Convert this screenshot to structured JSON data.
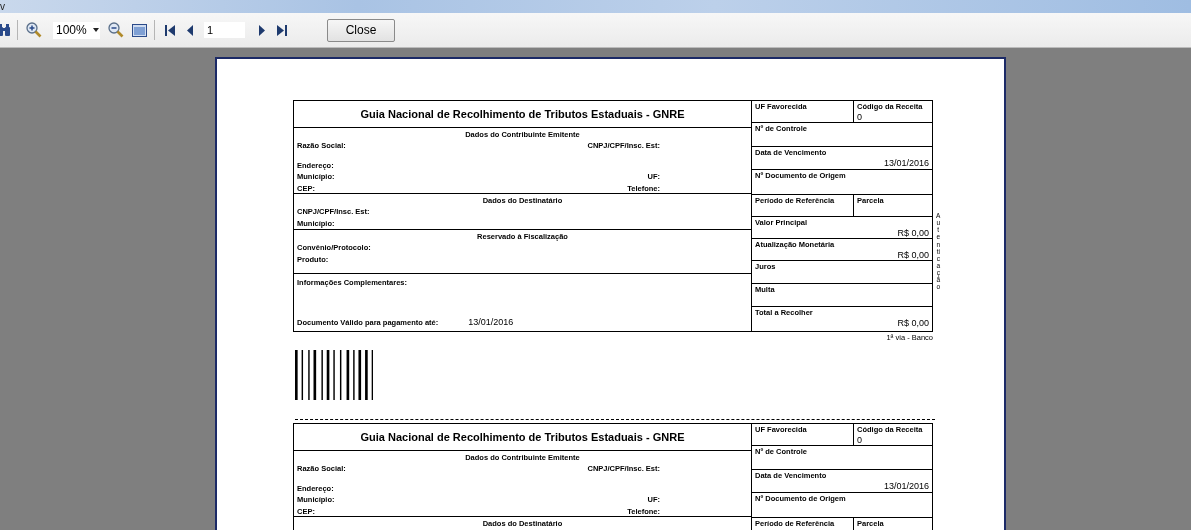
{
  "title_bar": {
    "text": "v"
  },
  "toolbar": {
    "zoom": "100%",
    "page": "1",
    "close": "Close"
  },
  "copies": [
    {
      "title": "Guia Nacional de Recolhimento de Tributos Estaduais - GNRE",
      "sections": [
        {
          "kind": "fields",
          "header": "Dados do Contribuinte Emitente",
          "lines": [
            {
              "left": "Razão Social:",
              "right": "CNPJ/CPF/Insc. Est:"
            },
            {
              "left": "Endereço:"
            },
            {
              "left": "Município:",
              "right": "UF:"
            },
            {
              "left": "CEP:",
              "right": "Telefone:"
            }
          ]
        },
        {
          "kind": "fields",
          "header": "Dados do Destinatário",
          "lines": [
            {
              "left": "CNPJ/CPF/Insc. Est:"
            },
            {
              "left": "Município:"
            }
          ]
        },
        {
          "kind": "fields",
          "header": "Reservado à Fiscalização",
          "lines": [
            {
              "left": "Convênio/Protocolo:"
            },
            {
              "left": "Produto:"
            }
          ]
        },
        {
          "kind": "info",
          "label": "Informações Complementares:",
          "due_label": "Documento Válido para pagamento até:",
          "due_value": "13/01/2016"
        }
      ],
      "right_rows": [
        [
          {
            "label": "UF Favorecida"
          },
          {
            "label": "Código da Receita",
            "value": "0"
          }
        ],
        [
          {
            "label": "Nº de Controle"
          }
        ],
        [
          {
            "label": "Data de Vencimento",
            "value": "13/01/2016"
          }
        ],
        [
          {
            "label": "Nº Documento de Origem"
          }
        ],
        [
          {
            "label": "Período de Referência"
          },
          {
            "label": "Parcela"
          }
        ],
        [
          {
            "label": "Valor Principal",
            "value": "R$ 0,00"
          }
        ],
        [
          {
            "label": "Atualização Monetária",
            "value": "R$ 0,00"
          }
        ],
        [
          {
            "label": "Juros"
          }
        ],
        [
          {
            "label": "Multa"
          }
        ],
        [
          {
            "label": "Total a Recolher",
            "value": "R$ 0,00"
          }
        ]
      ],
      "side_text": "Autenticação",
      "via": "1ª via - Banco",
      "barcode": true
    },
    {
      "title": "Guia Nacional de Recolhimento de Tributos Estaduais - GNRE",
      "sections": [
        {
          "kind": "fields",
          "header": "Dados do Contribuinte Emitente",
          "lines": [
            {
              "left": "Razão Social:",
              "right": "CNPJ/CPF/Insc. Est:"
            },
            {
              "left": "Endereço:"
            },
            {
              "left": "Município:",
              "right": "UF:"
            },
            {
              "left": "CEP:",
              "right": "Telefone:"
            }
          ]
        },
        {
          "kind": "fields",
          "header": "Dados do Destinatário"
        }
      ],
      "right_rows": [
        [
          {
            "label": "UF Favorecida"
          },
          {
            "label": "Código da Receita",
            "value": "0"
          }
        ],
        [
          {
            "label": "Nº de Controle"
          }
        ],
        [
          {
            "label": "Data de Vencimento",
            "value": "13/01/2016"
          }
        ],
        [
          {
            "label": "Nº Documento de Origem"
          }
        ],
        [
          {
            "label": "Período de Referência"
          },
          {
            "label": "Parcela"
          }
        ]
      ]
    }
  ]
}
